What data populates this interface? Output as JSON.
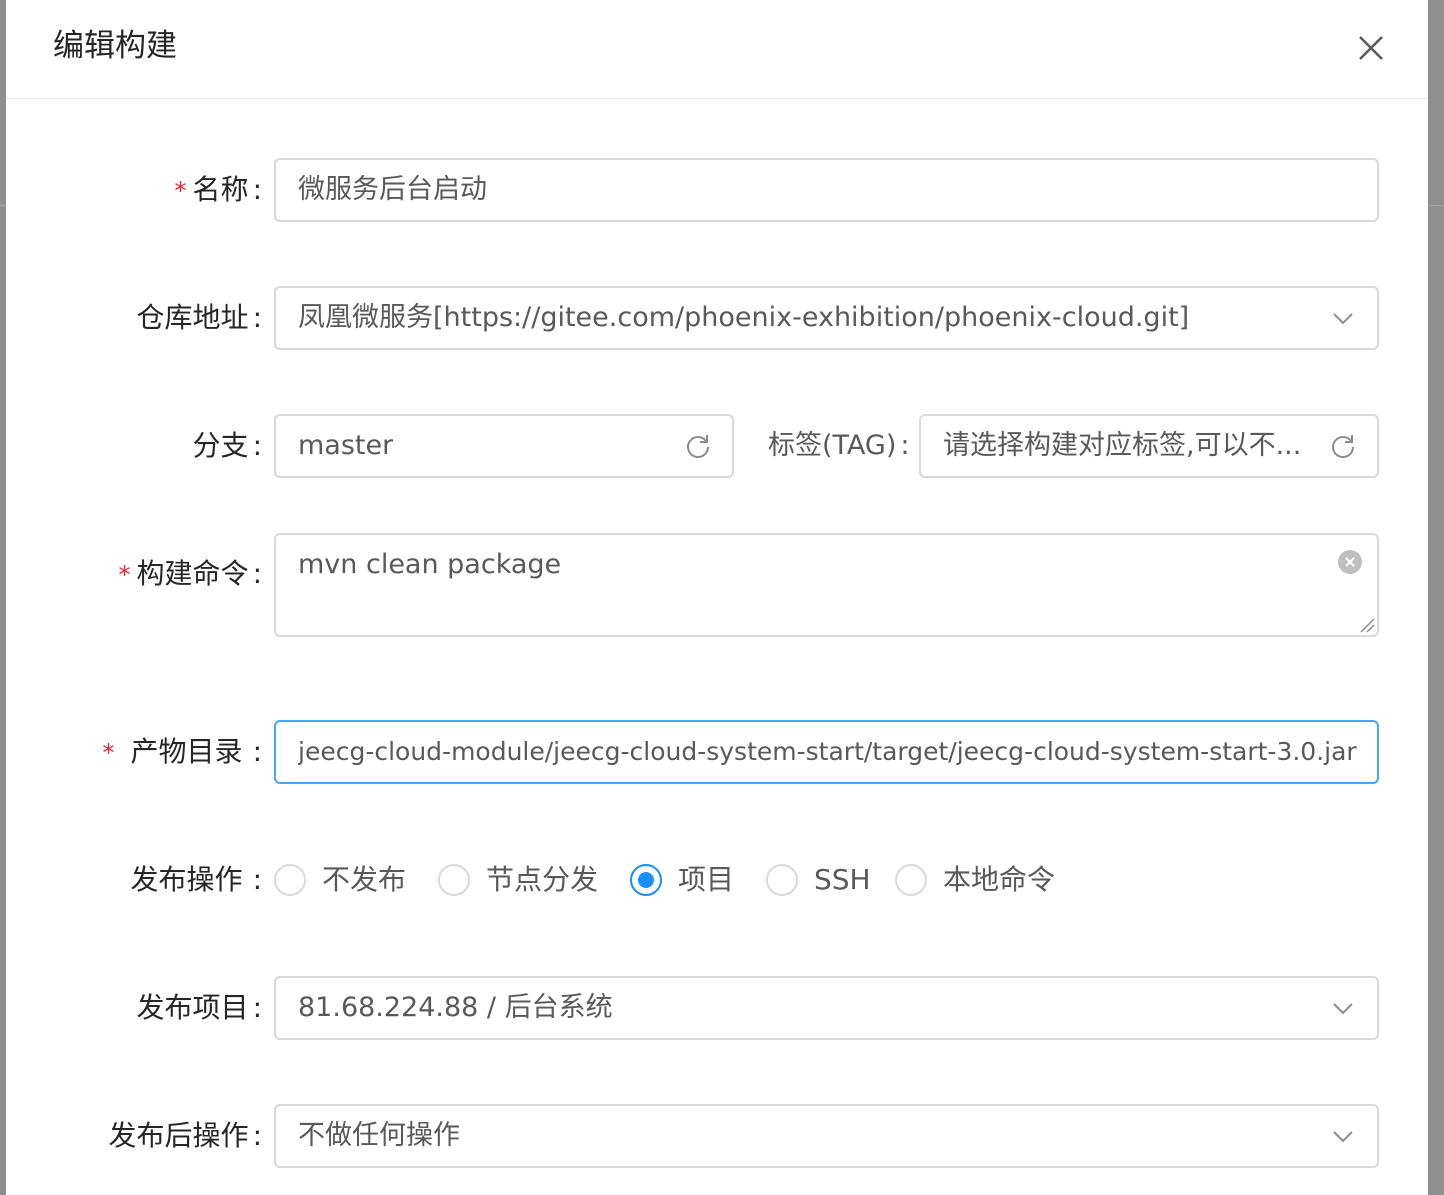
{
  "modal": {
    "title": "编辑构建"
  },
  "form": {
    "name": {
      "label": "名称",
      "required": true,
      "value": "微服务后台启动"
    },
    "repository": {
      "label": "仓库地址",
      "value": "凤凰微服务[https://gitee.com/phoenix-exhibition/phoenix-cloud.git]"
    },
    "branch": {
      "label": "分支",
      "value": "master"
    },
    "tag": {
      "label": "标签(TAG)",
      "placeholder": "请选择构建对应标签,可以不..."
    },
    "build_command": {
      "label": "构建命令",
      "required": true,
      "value": "mvn clean package"
    },
    "artifact_dir": {
      "label": "产物目录",
      "required": true,
      "value": "jeecg-cloud-module/jeecg-cloud-system-start/target/jeecg-cloud-system-start-3.0.jar"
    },
    "publish_action": {
      "label": "发布操作",
      "options": [
        "不发布",
        "节点分发",
        "项目",
        "SSH",
        "本地命令"
      ],
      "selected": "项目"
    },
    "publish_project": {
      "label": "发布项目",
      "value": "81.68.224.88 / 后台系统"
    },
    "post_publish_action": {
      "label": "发布后操作",
      "value": "不做任何操作"
    }
  },
  "colors": {
    "primary": "#1890ff",
    "required": "#f5222d",
    "border": "#d9d9d9",
    "focus_border": "#40a9ff"
  }
}
